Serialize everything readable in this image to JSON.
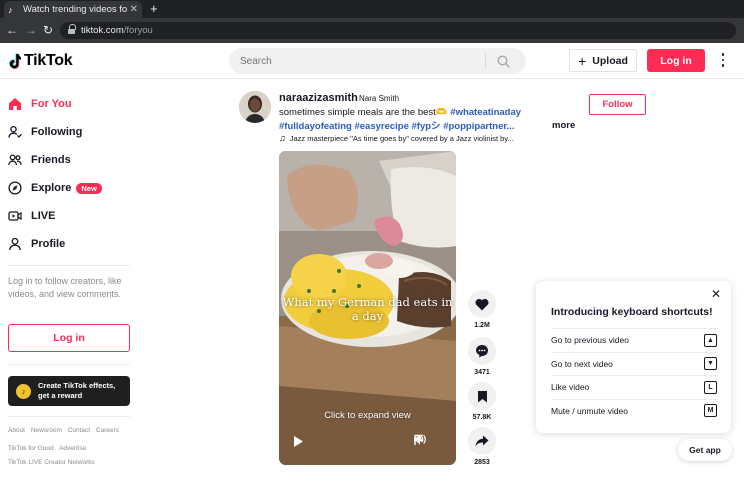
{
  "browser": {
    "tab_title": "Watch trending videos fo",
    "tab_close": "✕",
    "new_tab": "+",
    "url_host": "tiktok.com",
    "url_path": "/foryou"
  },
  "header": {
    "logo_text": "TikTok",
    "search_placeholder": "Search",
    "upload_label": "Upload",
    "login_label": "Log in",
    "brand_color": "#fe2c55"
  },
  "sidebar": {
    "items": [
      {
        "label": "For You",
        "icon": "home-icon",
        "active": true
      },
      {
        "label": "Following",
        "icon": "following-icon",
        "active": false
      },
      {
        "label": "Friends",
        "icon": "friends-icon",
        "active": false
      },
      {
        "label": "Explore",
        "icon": "compass-icon",
        "active": false,
        "badge": "New"
      },
      {
        "label": "LIVE",
        "icon": "live-icon",
        "active": false
      },
      {
        "label": "Profile",
        "icon": "profile-icon",
        "active": false
      }
    ],
    "login_prompt": "Log in to follow creators, like videos, and view comments.",
    "login_label": "Log in",
    "effects_line1": "Create TikTok effects,",
    "effects_line2": "get a reward",
    "footer_row1": [
      "About",
      "Newsroom",
      "Contact",
      "Careers"
    ],
    "footer_row2": [
      "TikTok for Good",
      "Advertise"
    ],
    "footer_row3": [
      "TikTok LIVE Creator Networks"
    ]
  },
  "post": {
    "username": "naraazizasmith",
    "nickname": "Nara Smith",
    "desc_text": "sometimes simple meals are the best🫶",
    "tags_line1": "#whateatinaday",
    "tags_line2": "#fulldayofeating #easyrecipe #fypシ #poppipartner...",
    "more": "more",
    "music": "Jazz masterpiece \"As time goes by\" covered by a Jazz violinist by...",
    "follow_label": "Follow",
    "video_caption": "What my German dad eats in a day",
    "expand_text": "Click to expand view",
    "likes": "1.2M",
    "comments": "3471",
    "saves": "57.8K",
    "shares": "2853"
  },
  "shortcuts": {
    "close": "✕",
    "title": "Introducing keyboard shortcuts!",
    "rows": [
      {
        "label": "Go to previous video",
        "key": "▲"
      },
      {
        "label": "Go to next video",
        "key": "▼"
      },
      {
        "label": "Like video",
        "key": "L"
      },
      {
        "label": "Mute / unmute video",
        "key": "M"
      }
    ]
  },
  "get_app": "Get app"
}
